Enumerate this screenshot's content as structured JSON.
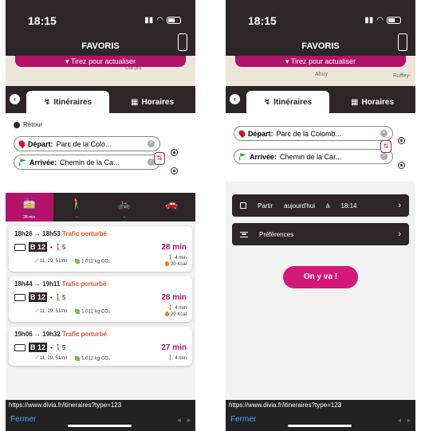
{
  "status": {
    "time": "18:15"
  },
  "header": {
    "title": "FAVORIS"
  },
  "refresh_label": "▾ Tirez pour actualiser",
  "map_labels": {
    "p1": "Darois",
    "p2_a": "Ahuy",
    "p2_b": "Ruffey-"
  },
  "tabs": {
    "itineraries": "Itinéraires",
    "schedules": "Horaires"
  },
  "back_label": "Retour",
  "form": {
    "depart_label": "Départ:",
    "depart_value_1": "Parc de la Colo...",
    "depart_value_2": "Parc de la Colomb...",
    "arrivee_label": "Arrivée:",
    "arrivee_value_1": "Chemin de la Ca...",
    "arrivee_value_2": "Chemin de la Car..."
  },
  "modes": [
    {
      "name": "transport",
      "sub": "28 min",
      "icon": "🚋"
    },
    {
      "name": "walk",
      "sub": "--",
      "icon": "🚶"
    },
    {
      "name": "bike",
      "sub": "--",
      "icon": "🚲"
    },
    {
      "name": "car",
      "sub": "",
      "icon": "🚗"
    }
  ],
  "results": [
    {
      "times": "18h26 → 18h53",
      "status": "Trafic perturbé",
      "line": "B 12",
      "walk": "5",
      "duration": "28 min",
      "stops": "11, 29, 51mn",
      "co2": "1.012 kg CO₂",
      "walk_time": "4 min",
      "kcal": "20 Kcal"
    },
    {
      "times": "18h44 → 19h11",
      "status": "Trafic perturbé",
      "line": "B 12",
      "walk": "5",
      "duration": "28 min",
      "stops": "11, 29, 51mn",
      "co2": "1.012 kg CO₂",
      "walk_time": "4 min",
      "kcal": "20 Kcal"
    },
    {
      "times": "19h06 → 19h32",
      "status": "Trafic perturbé",
      "line": "B 12",
      "walk": "5",
      "duration": "27 min",
      "stops": "11, 29, 51mn",
      "co2": "1.012 kg CO₂",
      "walk_time": "4 min",
      "kcal": ""
    }
  ],
  "depart_bar": {
    "label": "Partir",
    "when": "aujourd'hui",
    "at": "à",
    "time": "18:14"
  },
  "prefs_label": "Préférences",
  "go_label": "On y va !",
  "url": "https://www.divia.fr/itineraires?type=123",
  "close_label": "Fermer",
  "colors": {
    "accent": "#b3116a",
    "dark": "#2d2628",
    "warning": "#e8542a"
  }
}
